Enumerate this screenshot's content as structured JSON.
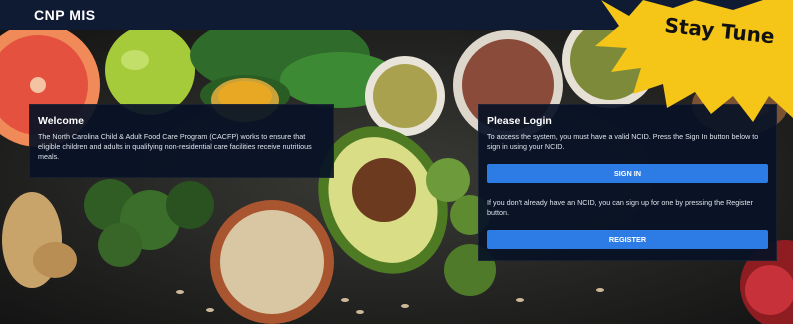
{
  "header": {
    "title": "CNP MIS"
  },
  "welcome": {
    "heading": "Welcome",
    "body": "The North Carolina Child & Adult Food Care Program (CACFP) works to ensure that eligible children and adults in qualifying non-residential care facilities receive nutritious meals."
  },
  "login": {
    "heading": "Please Login",
    "intro": "To access the system, you must have a valid NCID. Press the Sign In button below to sign in using your NCID.",
    "sign_in_label": "SIGN IN",
    "register_text": "If you don't already have an NCID, you can sign up for one by pressing the Register button.",
    "register_label": "REGISTER"
  },
  "banner": {
    "text": "Stay Tune"
  },
  "colors": {
    "header_bg": "#0f1a33",
    "panel_bg": "#081226",
    "button": "#2d7ce6",
    "burst": "#f5c518"
  }
}
